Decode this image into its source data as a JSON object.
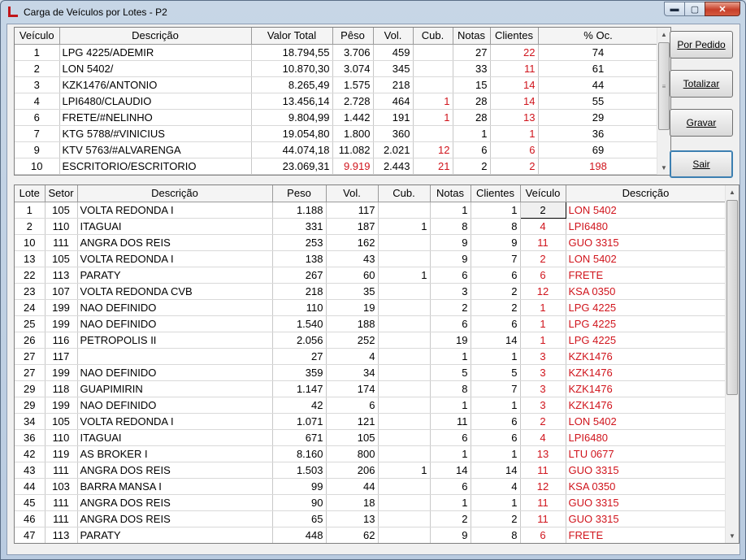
{
  "window": {
    "title": "Carga de Veículos por Lotes - P2",
    "controls": {
      "minimize": "▬",
      "maximize": "▢",
      "close": "✕"
    }
  },
  "buttons": {
    "por_pedido": "Por Pedido",
    "totalizar": "Totalizar",
    "gravar": "Gravar",
    "sair": "Sair"
  },
  "top_grid": {
    "headers": [
      "Veículo",
      "Descrição",
      "Valor Total",
      "Pêso",
      "Vol.",
      "Cub.",
      "Notas",
      "Clientes",
      "% Oc."
    ],
    "rows": [
      {
        "veiculo": "1",
        "descricao": "LPG 4225/ADEMIR",
        "valor": "18.794,55",
        "peso": "3.706",
        "vol": "459",
        "cub": "",
        "notas": "27",
        "clientes": "22",
        "oc": "74",
        "peso_red": false,
        "oc_red": false
      },
      {
        "veiculo": "2",
        "descricao": "LON 5402/",
        "valor": "10.870,30",
        "peso": "3.074",
        "vol": "345",
        "cub": "",
        "notas": "33",
        "clientes": "11",
        "oc": "61",
        "peso_red": false,
        "oc_red": false
      },
      {
        "veiculo": "3",
        "descricao": "KZK1476/ANTONIO",
        "valor": "8.265,49",
        "peso": "1.575",
        "vol": "218",
        "cub": "",
        "notas": "15",
        "clientes": "14",
        "oc": "44",
        "peso_red": false,
        "oc_red": false
      },
      {
        "veiculo": "4",
        "descricao": "LPI6480/CLAUDIO",
        "valor": "13.456,14",
        "peso": "2.728",
        "vol": "464",
        "cub": "1",
        "notas": "28",
        "clientes": "14",
        "oc": "55",
        "peso_red": false,
        "oc_red": false
      },
      {
        "veiculo": "6",
        "descricao": "FRETE/#NELINHO",
        "valor": "9.804,99",
        "peso": "1.442",
        "vol": "191",
        "cub": "1",
        "notas": "28",
        "clientes": "13",
        "oc": "29",
        "peso_red": false,
        "oc_red": false
      },
      {
        "veiculo": "7",
        "descricao": "KTG 5788/#VINICIUS",
        "valor": "19.054,80",
        "peso": "1.800",
        "vol": "360",
        "cub": "",
        "notas": "1",
        "clientes": "1",
        "oc": "36",
        "peso_red": false,
        "oc_red": false
      },
      {
        "veiculo": "9",
        "descricao": "KTV 5763/#ALVARENGA",
        "valor": "44.074,18",
        "peso": "11.082",
        "vol": "2.021",
        "cub": "12",
        "notas": "6",
        "clientes": "6",
        "oc": "69",
        "peso_red": false,
        "oc_red": false
      },
      {
        "veiculo": "10",
        "descricao": "ESCRITORIO/ESCRITORIO",
        "valor": "23.069,31",
        "peso": "9.919",
        "vol": "2.443",
        "cub": "21",
        "notas": "2",
        "clientes": "2",
        "oc": "198",
        "peso_red": true,
        "oc_red": true
      }
    ]
  },
  "bottom_grid": {
    "headers": [
      "Lote",
      "Setor",
      "Descrição",
      "Peso",
      "Vol.",
      "Cub.",
      "Notas",
      "Clientes",
      "Veículo",
      "Descrição"
    ],
    "rows": [
      {
        "lote": "1",
        "setor": "105",
        "descricao": "VOLTA REDONDA I",
        "peso": "1.188",
        "vol": "117",
        "cub": "",
        "notas": "1",
        "clientes": "1",
        "veiculo": "2",
        "vdesc": "LON 5402"
      },
      {
        "lote": "2",
        "setor": "110",
        "descricao": "ITAGUAI",
        "peso": "331",
        "vol": "187",
        "cub": "1",
        "notas": "8",
        "clientes": "8",
        "veiculo": "4",
        "vdesc": "LPI6480"
      },
      {
        "lote": "10",
        "setor": "111",
        "descricao": "ANGRA DOS REIS",
        "peso": "253",
        "vol": "162",
        "cub": "",
        "notas": "9",
        "clientes": "9",
        "veiculo": "11",
        "vdesc": "GUO 3315"
      },
      {
        "lote": "13",
        "setor": "105",
        "descricao": "VOLTA REDONDA I",
        "peso": "138",
        "vol": "43",
        "cub": "",
        "notas": "9",
        "clientes": "7",
        "veiculo": "2",
        "vdesc": "LON 5402"
      },
      {
        "lote": "22",
        "setor": "113",
        "descricao": "PARATY",
        "peso": "267",
        "vol": "60",
        "cub": "1",
        "notas": "6",
        "clientes": "6",
        "veiculo": "6",
        "vdesc": "FRETE"
      },
      {
        "lote": "23",
        "setor": "107",
        "descricao": "VOLTA REDONDA CVB",
        "peso": "218",
        "vol": "35",
        "cub": "",
        "notas": "3",
        "clientes": "2",
        "veiculo": "12",
        "vdesc": "KSA 0350"
      },
      {
        "lote": "24",
        "setor": "199",
        "descricao": "NAO DEFINIDO",
        "peso": "110",
        "vol": "19",
        "cub": "",
        "notas": "2",
        "clientes": "2",
        "veiculo": "1",
        "vdesc": "LPG 4225"
      },
      {
        "lote": "25",
        "setor": "199",
        "descricao": "NAO DEFINIDO",
        "peso": "1.540",
        "vol": "188",
        "cub": "",
        "notas": "6",
        "clientes": "6",
        "veiculo": "1",
        "vdesc": "LPG 4225"
      },
      {
        "lote": "26",
        "setor": "116",
        "descricao": "PETROPOLIS II",
        "peso": "2.056",
        "vol": "252",
        "cub": "",
        "notas": "19",
        "clientes": "14",
        "veiculo": "1",
        "vdesc": "LPG 4225"
      },
      {
        "lote": "27",
        "setor": "117",
        "descricao": "",
        "peso": "27",
        "vol": "4",
        "cub": "",
        "notas": "1",
        "clientes": "1",
        "veiculo": "3",
        "vdesc": "KZK1476"
      },
      {
        "lote": "27",
        "setor": "199",
        "descricao": "NAO DEFINIDO",
        "peso": "359",
        "vol": "34",
        "cub": "",
        "notas": "5",
        "clientes": "5",
        "veiculo": "3",
        "vdesc": "KZK1476"
      },
      {
        "lote": "29",
        "setor": "118",
        "descricao": "GUAPIMIRIN",
        "peso": "1.147",
        "vol": "174",
        "cub": "",
        "notas": "8",
        "clientes": "7",
        "veiculo": "3",
        "vdesc": "KZK1476"
      },
      {
        "lote": "29",
        "setor": "199",
        "descricao": "NAO DEFINIDO",
        "peso": "42",
        "vol": "6",
        "cub": "",
        "notas": "1",
        "clientes": "1",
        "veiculo": "3",
        "vdesc": "KZK1476"
      },
      {
        "lote": "34",
        "setor": "105",
        "descricao": "VOLTA REDONDA I",
        "peso": "1.071",
        "vol": "121",
        "cub": "",
        "notas": "11",
        "clientes": "6",
        "veiculo": "2",
        "vdesc": "LON 5402"
      },
      {
        "lote": "36",
        "setor": "110",
        "descricao": "ITAGUAI",
        "peso": "671",
        "vol": "105",
        "cub": "",
        "notas": "6",
        "clientes": "6",
        "veiculo": "4",
        "vdesc": "LPI6480"
      },
      {
        "lote": "42",
        "setor": "119",
        "descricao": "AS BROKER I",
        "peso": "8.160",
        "vol": "800",
        "cub": "",
        "notas": "1",
        "clientes": "1",
        "veiculo": "13",
        "vdesc": "LTU 0677"
      },
      {
        "lote": "43",
        "setor": "111",
        "descricao": "ANGRA DOS REIS",
        "peso": "1.503",
        "vol": "206",
        "cub": "1",
        "notas": "14",
        "clientes": "14",
        "veiculo": "11",
        "vdesc": "GUO 3315"
      },
      {
        "lote": "44",
        "setor": "103",
        "descricao": "BARRA MANSA I",
        "peso": "99",
        "vol": "44",
        "cub": "",
        "notas": "6",
        "clientes": "4",
        "veiculo": "12",
        "vdesc": "KSA 0350"
      },
      {
        "lote": "45",
        "setor": "111",
        "descricao": "ANGRA DOS REIS",
        "peso": "90",
        "vol": "18",
        "cub": "",
        "notas": "1",
        "clientes": "1",
        "veiculo": "11",
        "vdesc": "GUO 3315"
      },
      {
        "lote": "46",
        "setor": "111",
        "descricao": "ANGRA DOS REIS",
        "peso": "65",
        "vol": "13",
        "cub": "",
        "notas": "2",
        "clientes": "2",
        "veiculo": "11",
        "vdesc": "GUO 3315"
      },
      {
        "lote": "47",
        "setor": "113",
        "descricao": "PARATY",
        "peso": "448",
        "vol": "62",
        "cub": "",
        "notas": "9",
        "clientes": "8",
        "veiculo": "6",
        "vdesc": "FRETE"
      }
    ]
  },
  "colors": {
    "accent_red": "#d0141c",
    "close_button": "#c7402a"
  },
  "icons": {
    "scroll_up": "▲",
    "scroll_down": "▼",
    "grip": "≡"
  }
}
